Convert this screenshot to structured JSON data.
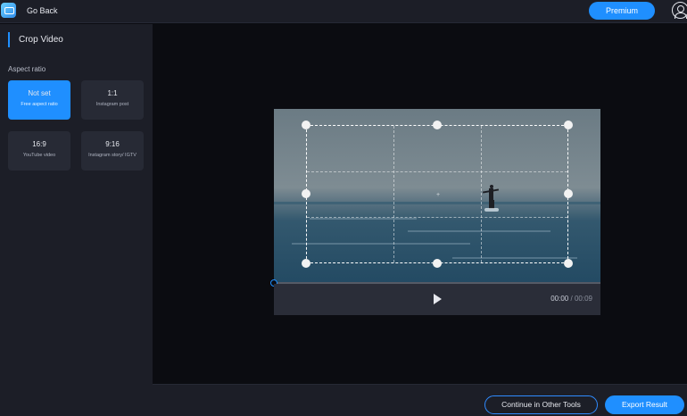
{
  "header": {
    "app_icon": "app-logo-icon",
    "go_back_label": "Go Back",
    "premium_label": "Premium",
    "account_icon": "user-account-icon"
  },
  "sidebar": {
    "title": "Crop Video",
    "aspect_ratio_label": "Aspect ratio",
    "ratios": [
      {
        "label": "Not set",
        "sub": "Free aspect ratio",
        "selected": true
      },
      {
        "label": "1:1",
        "sub": "Instagram post",
        "selected": false
      },
      {
        "label": "16:9",
        "sub": "YouTube video",
        "selected": false
      },
      {
        "label": "9:16",
        "sub": "Instagram story/ IGTV",
        "selected": false
      }
    ]
  },
  "player": {
    "current_time": "00:00",
    "separator": "/",
    "duration": "00:09",
    "play_icon": "play-icon"
  },
  "footer": {
    "continue_label": "Continue in Other Tools",
    "export_label": "Export Result"
  },
  "colors": {
    "accent": "#1f8fff",
    "panel": "#1c1e27",
    "background": "#0b0c11"
  }
}
